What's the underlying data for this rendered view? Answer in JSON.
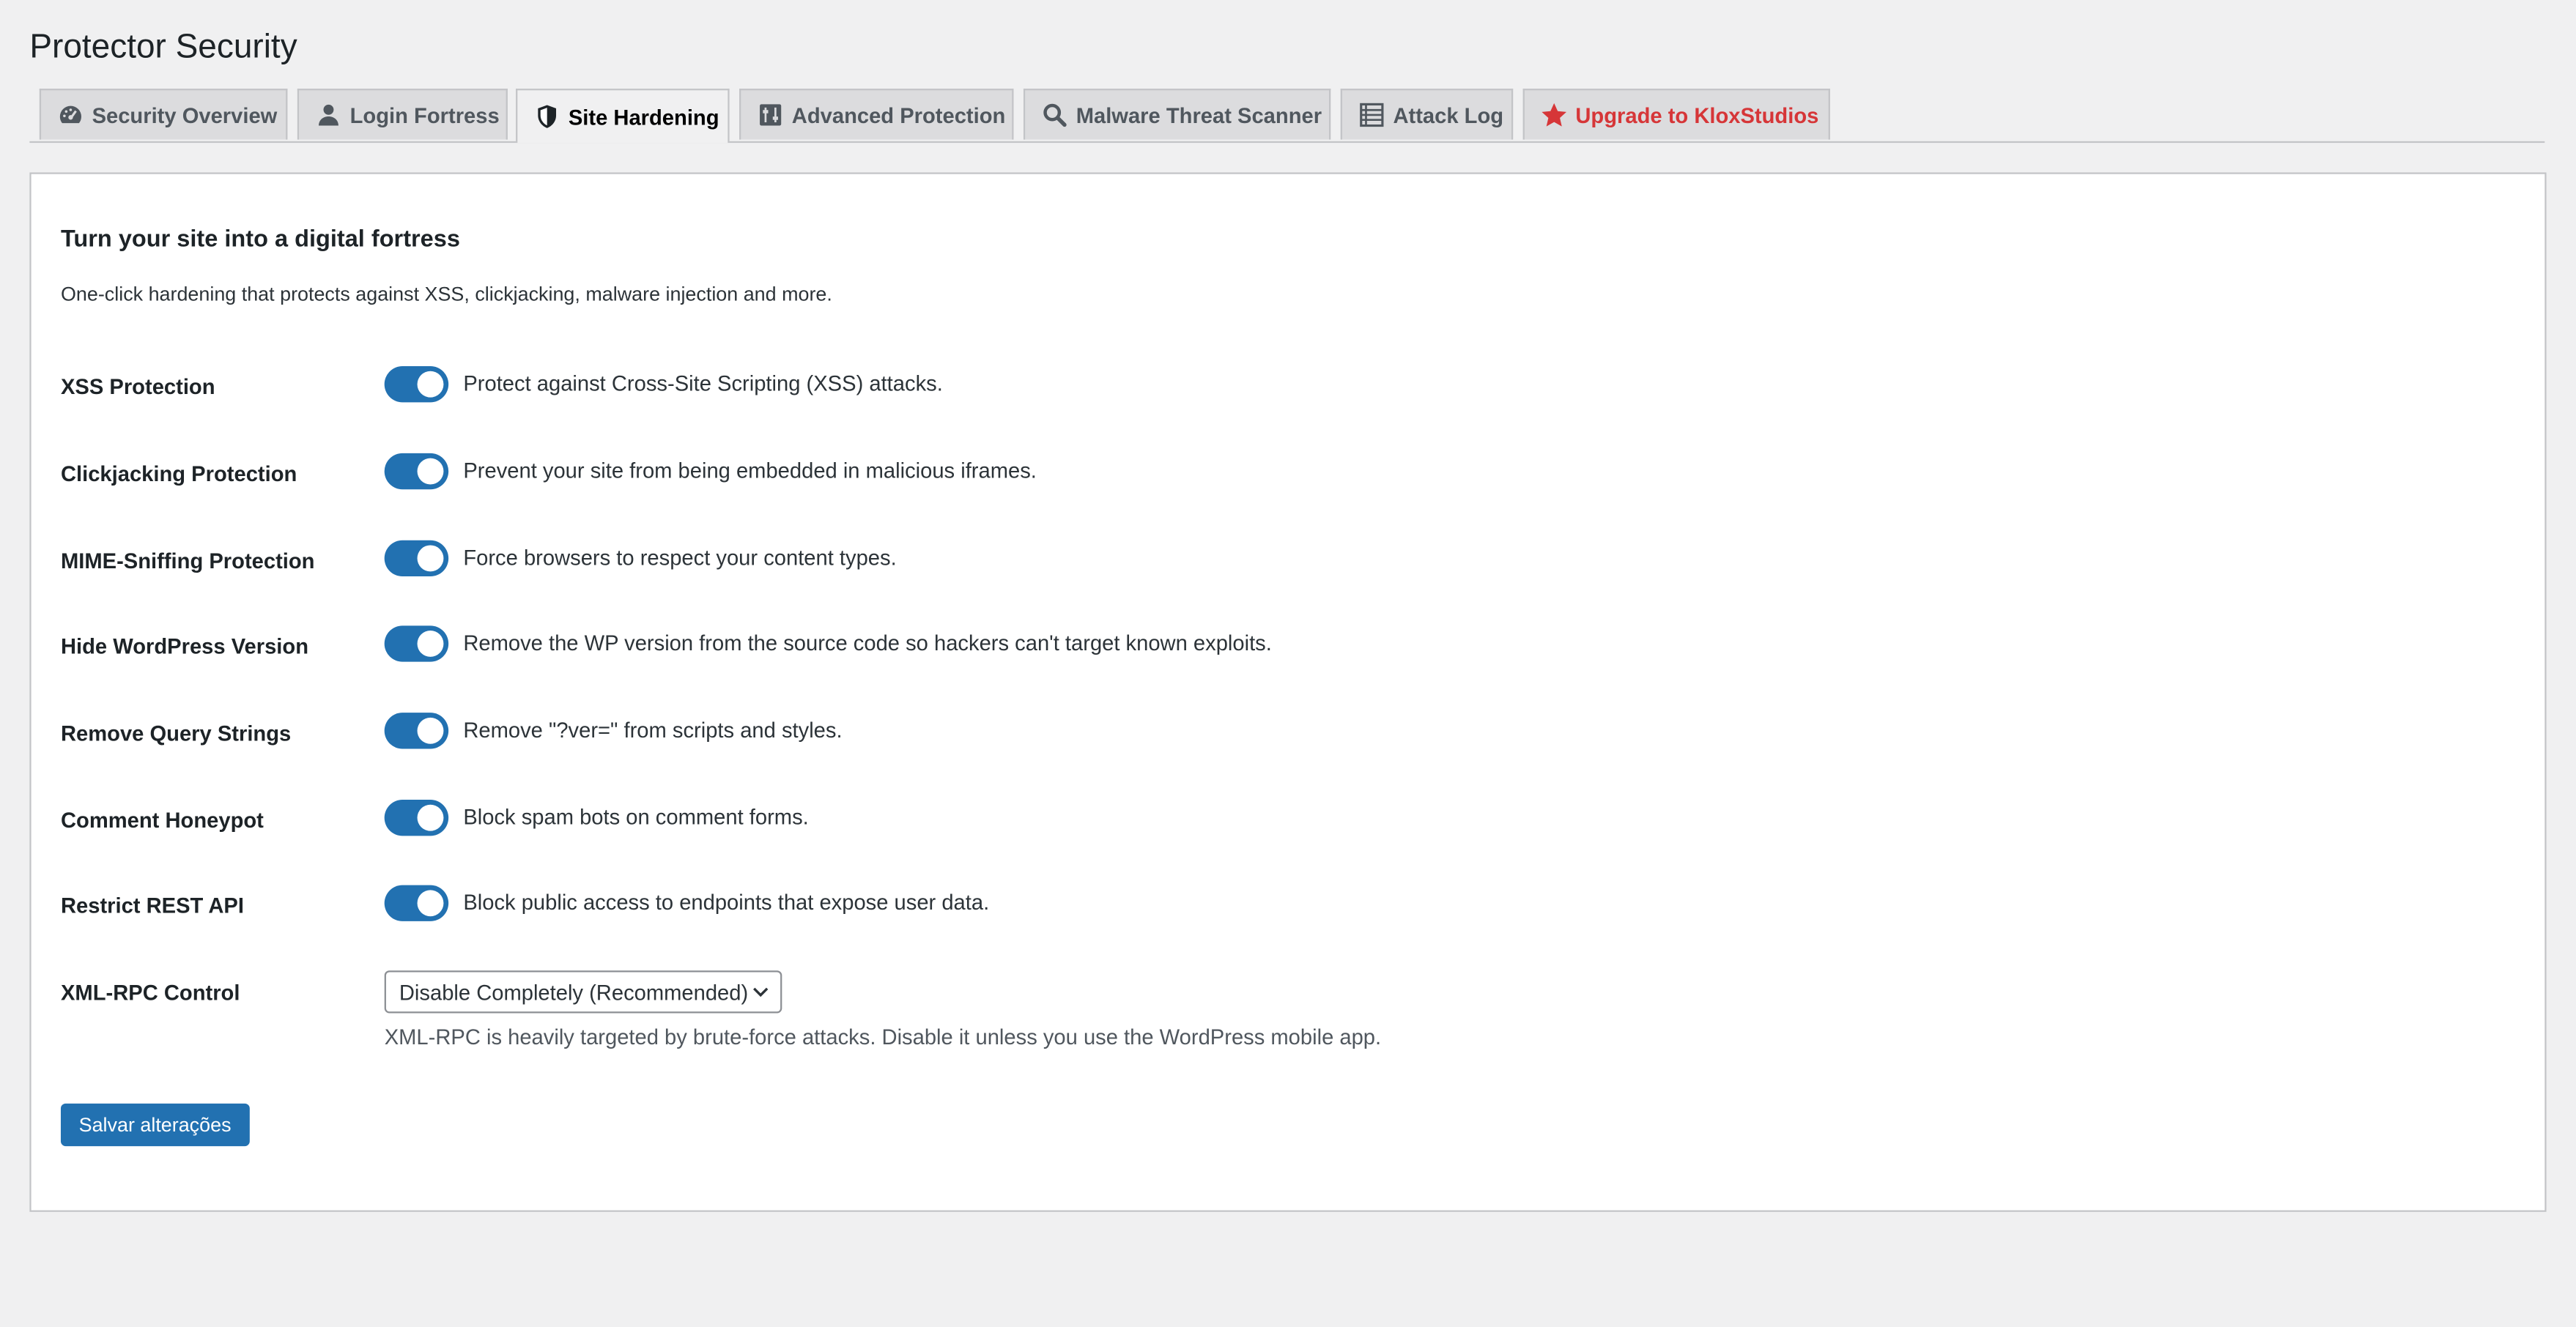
{
  "page": {
    "title": "Protector Security"
  },
  "tabs": [
    {
      "label": "Security Overview",
      "icon": "dashboard-gauge-icon",
      "active": false
    },
    {
      "label": "Login Fortress",
      "icon": "user-icon",
      "active": false
    },
    {
      "label": "Site Hardening",
      "icon": "shield-icon",
      "active": true
    },
    {
      "label": "Advanced Protection",
      "icon": "sliders-icon",
      "active": false
    },
    {
      "label": "Malware Threat Scanner",
      "icon": "search-icon",
      "active": false
    },
    {
      "label": "Attack Log",
      "icon": "list-icon",
      "active": false
    },
    {
      "label": "Upgrade to KloxStudios",
      "icon": "star-icon",
      "active": false
    }
  ],
  "panel": {
    "heading": "Turn your site into a digital fortress",
    "description": "One-click hardening that protects against XSS, clickjacking, malware injection and more."
  },
  "settings": [
    {
      "label": "XSS Protection",
      "description": "Protect against Cross-Site Scripting (XSS) attacks.",
      "enabled": true
    },
    {
      "label": "Clickjacking Protection",
      "description": "Prevent your site from being embedded in malicious iframes.",
      "enabled": true
    },
    {
      "label": "MIME-Sniffing Protection",
      "description": "Force browsers to respect your content types.",
      "enabled": true
    },
    {
      "label": "Hide WordPress Version",
      "description": "Remove the WP version from the source code so hackers can't target known exploits.",
      "enabled": true
    },
    {
      "label": "Remove Query Strings",
      "description": "Remove \"?ver=\" from scripts and styles.",
      "enabled": true
    },
    {
      "label": "Comment Honeypot",
      "description": "Block spam bots on comment forms.",
      "enabled": true
    },
    {
      "label": "Restrict REST API",
      "description": "Block public access to endpoints that expose user data.",
      "enabled": true
    }
  ],
  "xmlrpc": {
    "label": "XML-RPC Control",
    "selected": "Disable Completely (Recommended)",
    "help": "XML-RPC is heavily targeted by brute-force attacks. Disable it unless you use the WordPress mobile app."
  },
  "save_button": {
    "label": "Salvar alterações"
  },
  "colors": {
    "accent": "#2271b1",
    "upgrade": "#d63638",
    "background": "#f0f0f1"
  }
}
